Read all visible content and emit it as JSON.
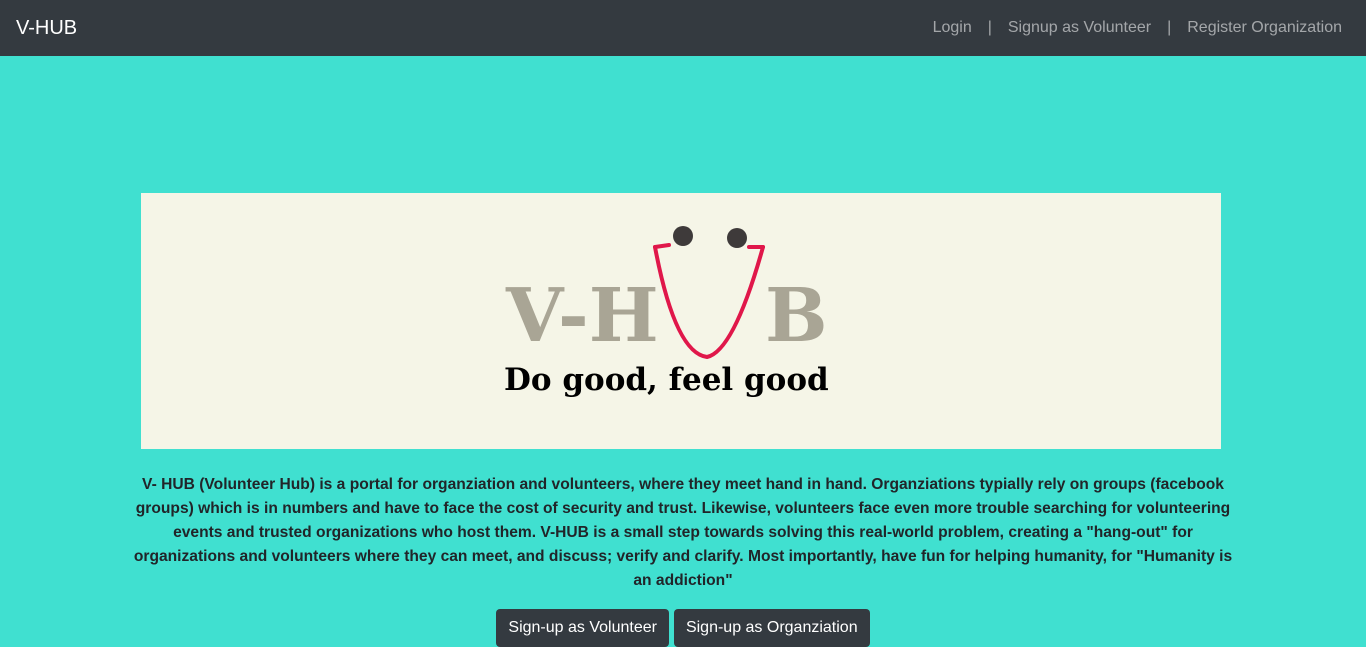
{
  "navbar": {
    "brand": "V-HUB",
    "links": [
      {
        "label": "Login"
      },
      {
        "label": "Signup as Volunteer"
      },
      {
        "label": "Register Organization"
      }
    ],
    "separator": "|"
  },
  "banner": {
    "logo_left": "V-H",
    "logo_right": "B",
    "tagline": "Do good, feel good",
    "colors": {
      "background": "#f5f5e7",
      "logo_text": "#a9a595",
      "smile": "#e0174a",
      "eyes": "#3e3a3a"
    }
  },
  "main": {
    "description": "V- HUB (Volunteer Hub) is a portal for organziation and volunteers, where they meet hand in hand. Organziations typially rely on groups (facebook groups) which is in numbers and have to face the cost of security and trust. Likewise, volunteers face even more trouble searching for volunteering events and trusted organizations who host them. V-HUB is a small step towards solving this real-world problem, creating a \"hang-out\" for organizations and volunteers where they can meet, and discuss; verify and clarify. Most importantly, have fun for helping humanity, for \"Humanity is an addiction\"",
    "buttons": {
      "volunteer": "Sign-up as Volunteer",
      "organization": "Sign-up as Organziation"
    }
  },
  "colors": {
    "page_background": "#40e0d0",
    "navbar_background": "#343a40",
    "button_background": "#343a40"
  }
}
